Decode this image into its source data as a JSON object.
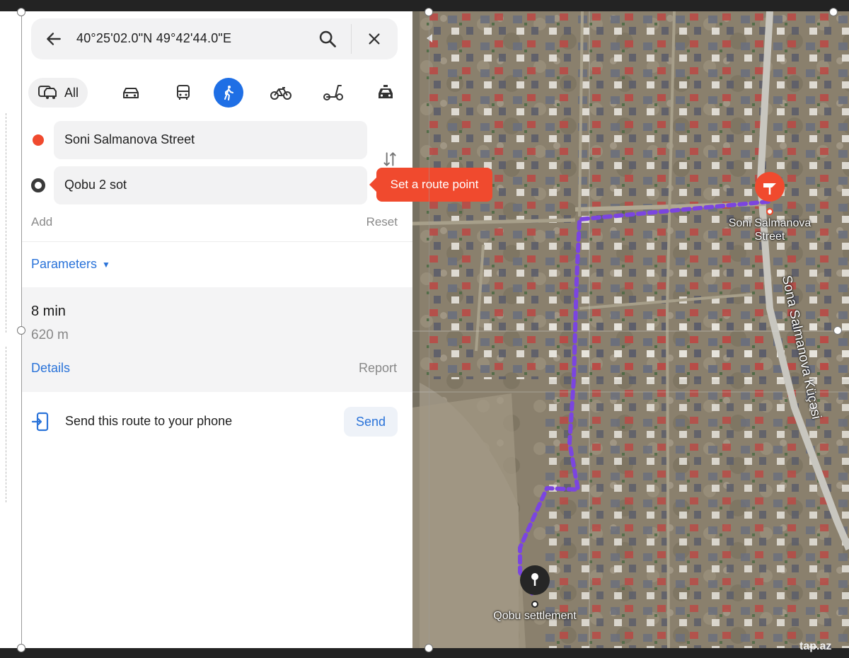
{
  "search": {
    "coordinates": "40°25'02.0\"N 49°42'44.0\"E"
  },
  "modes": {
    "all_label": "All",
    "items": [
      "car",
      "bus",
      "walking",
      "bicycle",
      "scooter",
      "taxi"
    ],
    "active": "walking"
  },
  "waypoints": {
    "from": "Soni Salmanova Street",
    "to": "Qobu 2 sot",
    "add_label": "Add",
    "reset_label": "Reset"
  },
  "tooltip": "Set a route point",
  "parameters_label": "Parameters",
  "route": {
    "time": "8 min",
    "distance": "620 m",
    "details_label": "Details",
    "report_label": "Report"
  },
  "send": {
    "text": "Send this route to your phone",
    "button": "Send"
  },
  "map": {
    "start_label_line1": "Soni Salmanova",
    "start_label_line2": "Street",
    "end_label": "Qobu settlement",
    "street_label": "Sona Salmanova Küçəsi"
  },
  "watermark": "tap.az",
  "colors": {
    "accent": "#1f6fe5",
    "link": "#2a73d9",
    "start_point": "#f04a2e",
    "route": "#7b45e0"
  }
}
